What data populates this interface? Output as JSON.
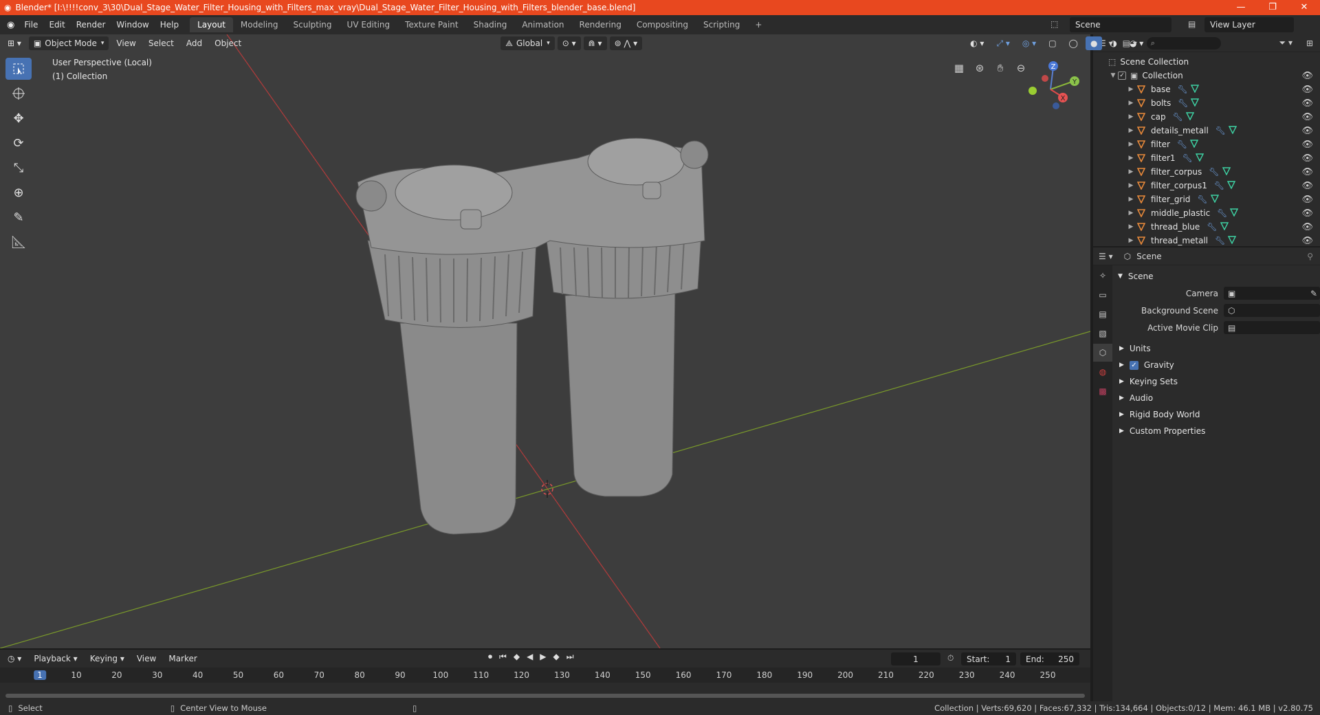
{
  "window": {
    "title": "Blender* [I:\\!!!!conv_3\\30\\Dual_Stage_Water_Filter_Housing_with_Filters_max_vray\\Dual_Stage_Water_Filter_Housing_with_Filters_blender_base.blend]",
    "minimize": "—",
    "maximize": "❐",
    "close": "✕"
  },
  "menu": [
    "File",
    "Edit",
    "Render",
    "Window",
    "Help"
  ],
  "workspaces": [
    "Layout",
    "Modeling",
    "Sculpting",
    "UV Editing",
    "Texture Paint",
    "Shading",
    "Animation",
    "Rendering",
    "Compositing",
    "Scripting"
  ],
  "workspace_add": "+",
  "scene_name": "Scene",
  "view_layer": "View Layer",
  "viewport": {
    "mode": "Object Mode",
    "menus": [
      "View",
      "Select",
      "Add",
      "Object"
    ],
    "transform": "Global",
    "perspective_label": "User Perspective (Local)",
    "collection_label": "(1) Collection",
    "gizmo_axes": {
      "x": "X",
      "y": "Y",
      "z": "Z"
    }
  },
  "outliner": {
    "root": "Scene Collection",
    "collection": "Collection",
    "objects": [
      "base",
      "bolts",
      "cap",
      "details_metall",
      "filter",
      "filter1",
      "filter_corpus",
      "filter_corpus1",
      "filter_grid",
      "middle_plastic",
      "thread_blue",
      "thread_metall"
    ]
  },
  "properties": {
    "header": "Scene",
    "panel": "Scene",
    "rows": [
      {
        "label": "Camera"
      },
      {
        "label": "Background Scene"
      },
      {
        "label": "Active Movie Clip"
      }
    ],
    "subpanels": [
      "Units",
      "Gravity",
      "Keying Sets",
      "Audio",
      "Rigid Body World",
      "Custom Properties"
    ]
  },
  "timeline": {
    "menus": [
      "Playback",
      "Keying",
      "View",
      "Marker"
    ],
    "current_frame": "1",
    "start_label": "Start:",
    "start": "1",
    "end_label": "End:",
    "end": "250",
    "ruler": [
      "1",
      "10",
      "20",
      "30",
      "40",
      "50",
      "60",
      "70",
      "80",
      "90",
      "100",
      "110",
      "120",
      "130",
      "140",
      "150",
      "160",
      "170",
      "180",
      "190",
      "200",
      "210",
      "220",
      "230",
      "240",
      "250"
    ]
  },
  "status": {
    "left": "Select",
    "middle": "Center View to Mouse",
    "right": "Collection | Verts:69,620 | Faces:67,332 | Tris:134,664 | Objects:0/12 | Mem: 46.1 MB | v2.80.75"
  },
  "colors": {
    "accent": "#4772b3",
    "titlebar": "#e8481f",
    "object_icon": "#e8893a",
    "mesh_icon": "#3ed1a3",
    "wrench_icon": "#6fa0e0"
  }
}
